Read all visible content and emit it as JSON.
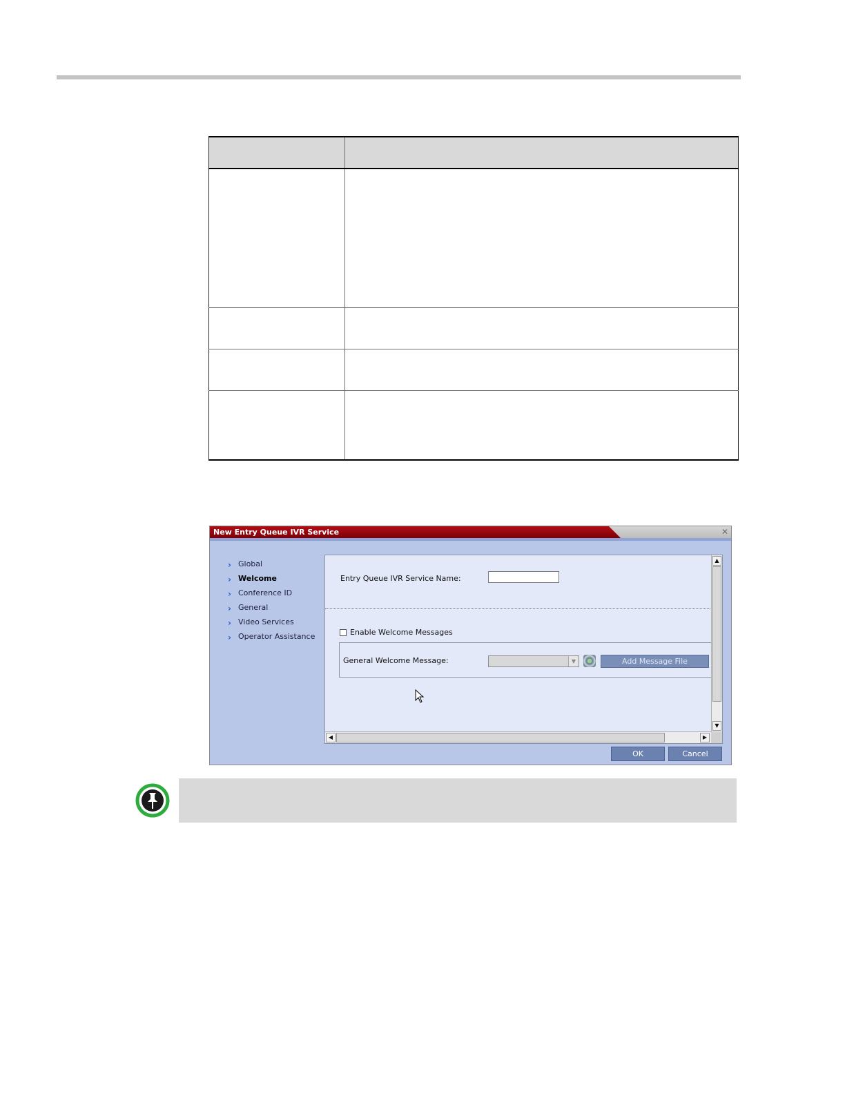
{
  "dialog": {
    "title": "New Entry Queue IVR Service",
    "close_icon": "close-icon",
    "nav_items": [
      {
        "label": "Global",
        "active": false
      },
      {
        "label": "Welcome",
        "active": true
      },
      {
        "label": "Conference ID",
        "active": false
      },
      {
        "label": "General",
        "active": false
      },
      {
        "label": "Video Services",
        "active": false
      },
      {
        "label": "Operator Assistance",
        "active": false
      }
    ],
    "service_name_label": "Entry Queue IVR Service Name:",
    "service_name_value": "",
    "enable_welcome_label": "Enable Welcome Messages",
    "enable_welcome_checked": false,
    "general_welcome_label": "General Welcome Message:",
    "general_welcome_value": "",
    "add_message_label": "Add Message File",
    "ok_label": "OK",
    "cancel_label": "Cancel"
  },
  "colors": {
    "title_red": "#9a0a12",
    "dialog_bg": "#b8c6e8",
    "panel_bg": "#e3e9f8",
    "button_blue": "#6b82b0",
    "note_bg": "#d9d9d9",
    "note_icon_green": "#2eab3e"
  },
  "note": {
    "icon": "pushpin-note-icon"
  }
}
